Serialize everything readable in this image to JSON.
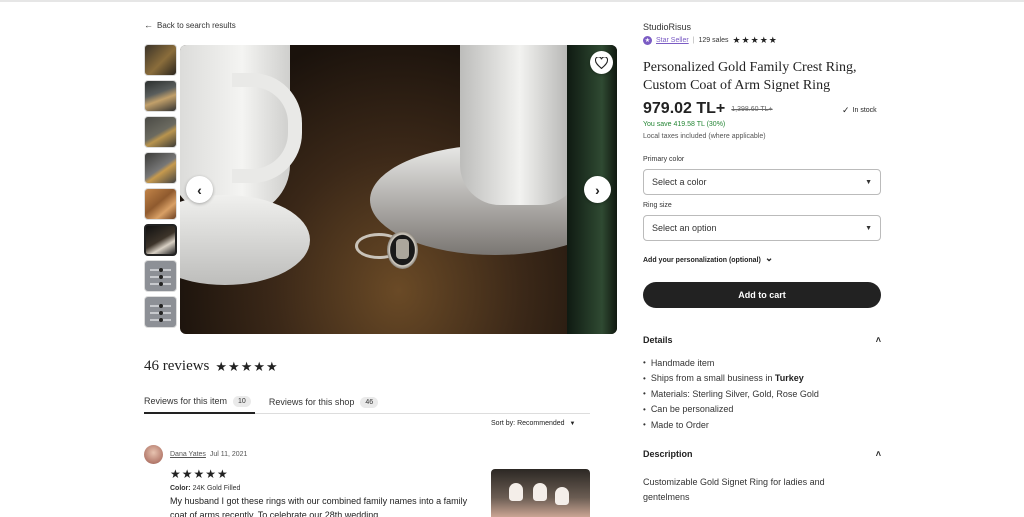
{
  "nav": {
    "back_label": "Back to search results",
    "back_arrow": "←"
  },
  "gallery": {
    "thumbnail_count": 8,
    "active_index": 5,
    "favorite_icon": "heart-outline-icon",
    "prev_icon": "‹",
    "next_icon": "›"
  },
  "reviews": {
    "count_label": "46 reviews",
    "stars": "★★★★★",
    "tabs": [
      {
        "label": "Reviews for this item",
        "count": "10"
      },
      {
        "label": "Reviews for this shop",
        "count": "46"
      }
    ],
    "sort_label": "Sort by:",
    "sort_value": "Recommended",
    "sort_caret": "▼",
    "items": [
      {
        "name": "Dana Yates",
        "date": "Jul 11, 2021",
        "stars": "★★★★★",
        "meta_key": "Color:",
        "meta_value": "24K Gold Filled",
        "text": "My husband I got these rings with our combined family names into a family coat of arms recently. To celebrate our 28th wedding"
      }
    ]
  },
  "product": {
    "shop_name": "StudioRisus",
    "star_seller_label": "Star Seller",
    "sales": "129 sales",
    "rating_stars": "★★★★★",
    "title": "Personalized Gold Family Crest Ring, Custom Coat of Arm Signet Ring",
    "price": "979.02 TL+",
    "old_price": "1,398.60 TL+",
    "stock_label": "In stock",
    "stock_check": "✓",
    "savings": "You save 419.58 TL (30%)",
    "taxes": "Local taxes included (where applicable)",
    "primary_color_label": "Primary color",
    "primary_color_value": "Select a color",
    "ring_size_label": "Ring size",
    "ring_size_value": "Select an option",
    "select_caret": "▼",
    "personalization_label": "Add your personalization (optional)",
    "personalization_chev": "⌄",
    "cart_label": "Add to cart"
  },
  "details": {
    "heading": "Details",
    "chevron": "˄",
    "items": [
      {
        "text": "Handmade item",
        "bold": ""
      },
      {
        "text": "Ships from a small business in ",
        "bold": "Turkey"
      },
      {
        "text": "Materials: Sterling Silver, Gold, Rose Gold",
        "bold": ""
      },
      {
        "text": "Can be personalized",
        "bold": ""
      },
      {
        "text": "Made to Order",
        "bold": ""
      }
    ]
  },
  "description": {
    "heading": "Description",
    "chevron": "˄",
    "text": "Customizable Gold Signet Ring for ladies and gentelmens"
  },
  "colors": {
    "star_seller": "#7b5cc4",
    "savings": "#258635",
    "cart_bg": "#222222"
  }
}
